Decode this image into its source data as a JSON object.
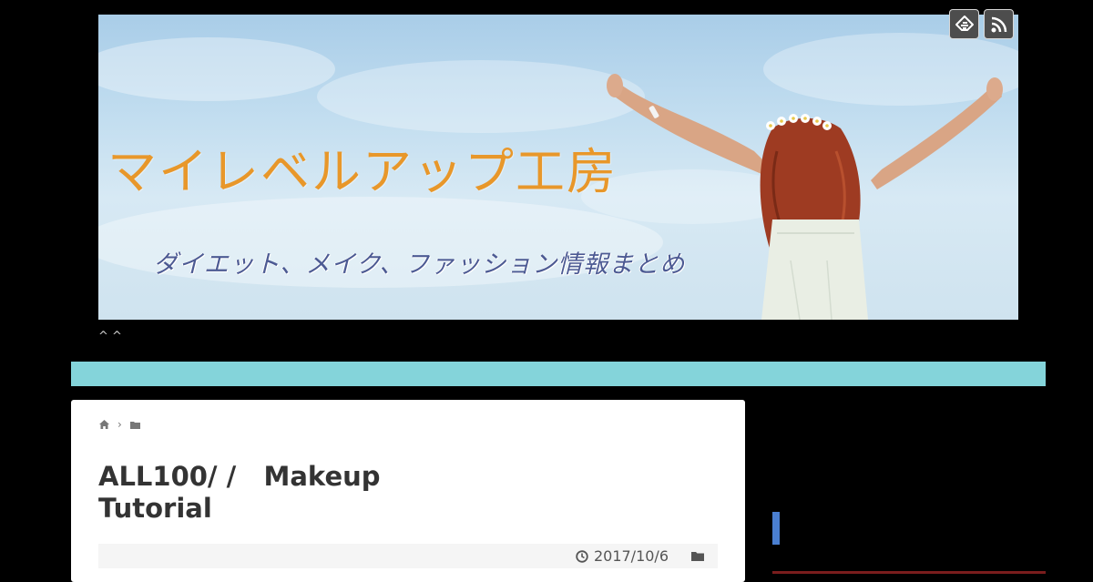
{
  "header": {
    "site_title": "マイレベルアップ工房",
    "site_subtitle": "ダイエット、メイク、ファッション情報まとめ",
    "tagline": "^ ^"
  },
  "follow_icons": [
    {
      "name": "feedly-icon"
    },
    {
      "name": "rss-icon"
    }
  ],
  "nav": {
    "color": "#84d4da"
  },
  "breadcrumb": {
    "home_icon": "home-icon",
    "separator": "›",
    "category_icon": "folder-icon"
  },
  "post": {
    "title": "ALL100/ /   Makeup\nTutorial",
    "date": "2017/10/6",
    "clock_icon": "clock-icon",
    "category_icon": "folder-icon"
  },
  "colors": {
    "background": "#000000",
    "title_orange": "#e8972a",
    "subtitle_blue": "#4c5a93",
    "sidebar_accent": "#4a7fd1"
  }
}
